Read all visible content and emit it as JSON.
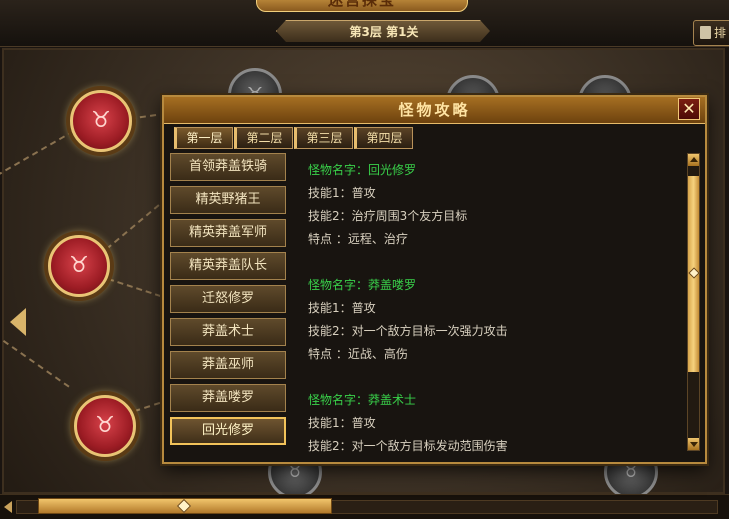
{
  "header": {
    "title": "迷宫探宝",
    "floor_label": "第3层  第1关",
    "ranking_label": "排"
  },
  "dialog": {
    "title": "怪物攻略",
    "close_label": "✕",
    "tabs": [
      {
        "label": "第一层"
      },
      {
        "label": "第二层"
      },
      {
        "label": "第三层"
      },
      {
        "label": "第四层"
      }
    ],
    "monsters": [
      {
        "label": "首领莽盖铁骑"
      },
      {
        "label": "精英野猪王"
      },
      {
        "label": "精英莽盖军师"
      },
      {
        "label": "精英莽盖队长"
      },
      {
        "label": "迁怒修罗"
      },
      {
        "label": "莽盖术士"
      },
      {
        "label": "莽盖巫师"
      },
      {
        "label": "莽盖喽罗"
      },
      {
        "label": "回光修罗"
      }
    ],
    "selected_monster": "回光修罗",
    "details": [
      {
        "name": "怪物名字：回光修罗",
        "skill1": "技能1：普攻",
        "skill2": "技能2：治疗周围3个友方目标",
        "trait": "特点  ：远程、治疗"
      },
      {
        "name": "怪物名字：莽盖喽罗",
        "skill1": "技能1：普攻",
        "skill2": "技能2：对一个敌方目标一次强力攻击",
        "trait": "特点  ：近战、高伤"
      },
      {
        "name": "怪物名字：莽盖术士",
        "skill1": "技能1：普攻",
        "skill2": "技能2：对一个敌方目标发动范围伤害"
      }
    ]
  },
  "icons": {
    "boss_node": "bull-head-icon",
    "locked_node": "bull-head-gray-icon",
    "left_arrow": "chevron-left-icon"
  },
  "colors": {
    "accent": "#b78a3e",
    "monster_name": "#39d14a",
    "text": "#d8d0bf"
  }
}
